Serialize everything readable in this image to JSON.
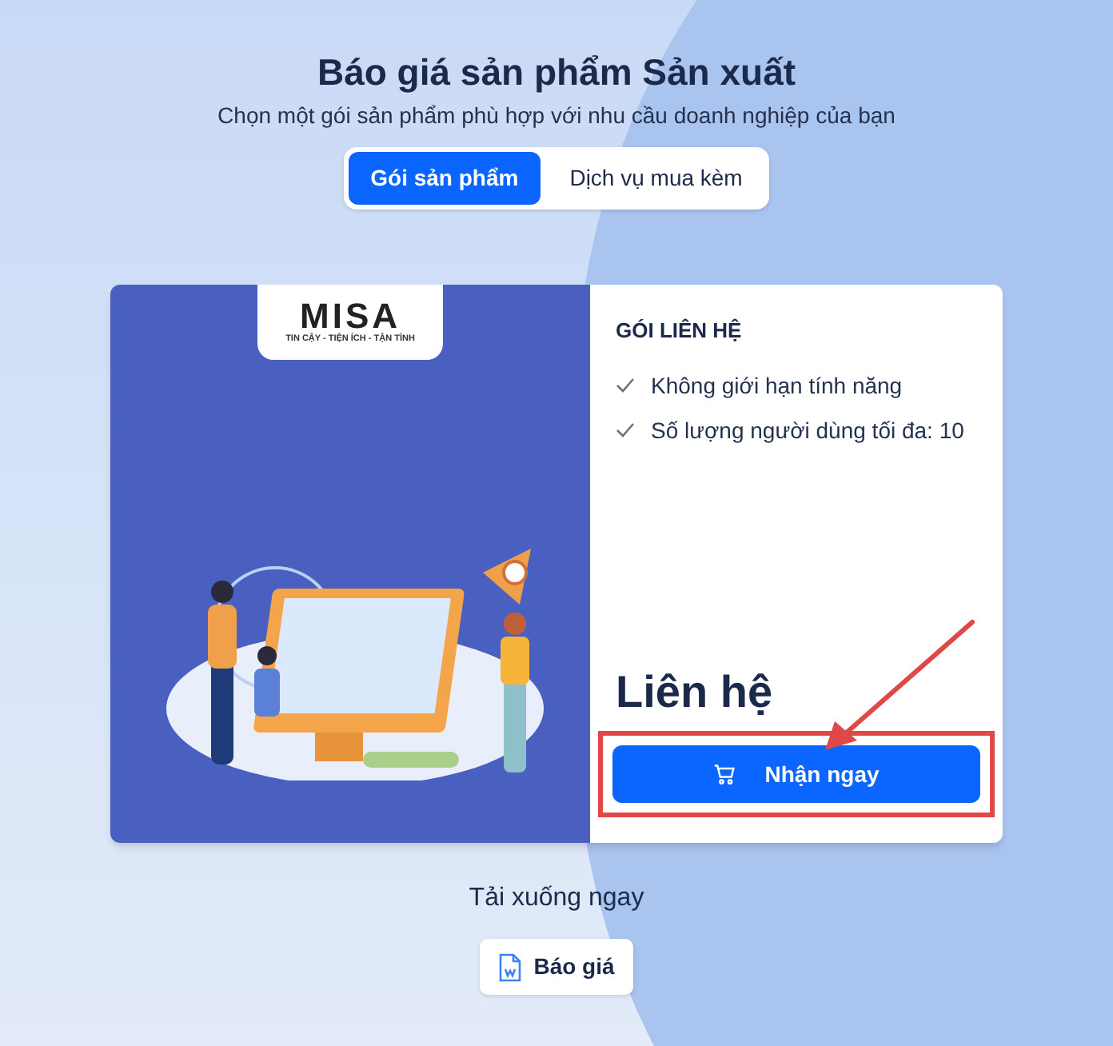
{
  "header": {
    "title": "Báo giá sản phẩm Sản xuất",
    "subtitle": "Chọn một gói sản phẩm phù hợp với nhu cầu doanh nghiệp của bạn"
  },
  "tabs": [
    {
      "label": "Gói sản phẩm",
      "selected": true
    },
    {
      "label": "Dịch vụ mua kèm",
      "selected": false
    }
  ],
  "plan_card": {
    "logo": {
      "wordmark": "MISA",
      "tagline": "TIN CẬY - TIỆN ÍCH - TẬN TÌNH"
    },
    "plan_name": "GÓI LIÊN HỆ",
    "features": [
      "Không giới hạn tính năng",
      "Số lượng người dùng tối đa: 10"
    ],
    "price": "Liên hệ",
    "button": "Nhận ngay"
  },
  "download": {
    "label": "Tải xuống ngay",
    "button": "Báo giá"
  }
}
